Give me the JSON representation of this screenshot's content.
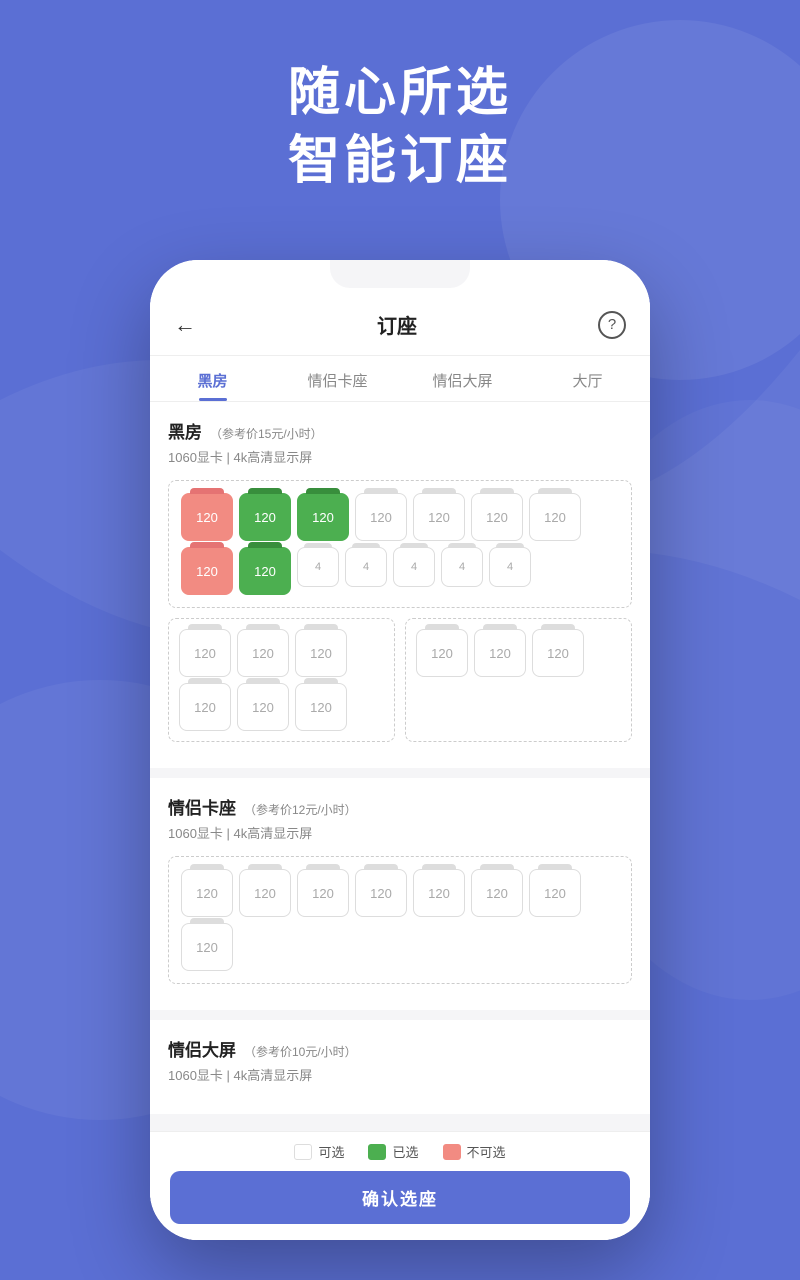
{
  "hero": {
    "line1": "随心所选",
    "line2": "智能订座"
  },
  "header": {
    "title": "订座",
    "back_icon": "←",
    "help_icon": "?"
  },
  "tabs": [
    {
      "label": "黑房",
      "active": true
    },
    {
      "label": "情侣卡座",
      "active": false
    },
    {
      "label": "情侣大屏",
      "active": false
    },
    {
      "label": "大厅",
      "active": false
    }
  ],
  "sections": [
    {
      "id": "heifang",
      "title": "黑房",
      "price": "（参考价15元/小时）",
      "specs": "1060显卡  |  4k高清显示屏"
    },
    {
      "id": "qinglv_ka",
      "title": "情侣卡座",
      "price": "（参考价12元/小时）",
      "specs": "1060显卡  |  4k高清显示屏"
    },
    {
      "id": "qinglv_da",
      "title": "情侣大屏",
      "price": "（参考价10元/小时）",
      "specs": "1060显卡  |  4k高清显示屏"
    }
  ],
  "legend": {
    "available": "可选",
    "selected": "已选",
    "occupied": "不可选"
  },
  "confirm_button": "确认选座"
}
